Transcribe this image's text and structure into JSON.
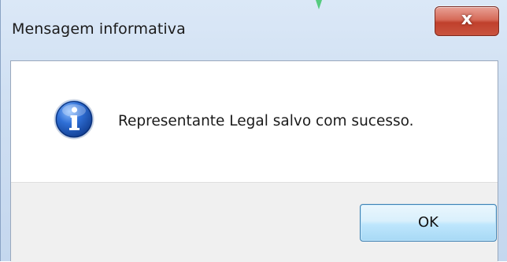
{
  "dialog": {
    "title": "Mensagem informativa",
    "close_glyph": "x",
    "message": "Representante Legal salvo com sucesso.",
    "icon": "information-icon",
    "ok_label": "OK"
  },
  "colors": {
    "titlebar": "#cfdff2",
    "close_button": "#c9543f",
    "button_area": "#f0f0f0",
    "ok_button_border": "#3c7fb1",
    "info_icon_blue": "#1f5bbf"
  }
}
